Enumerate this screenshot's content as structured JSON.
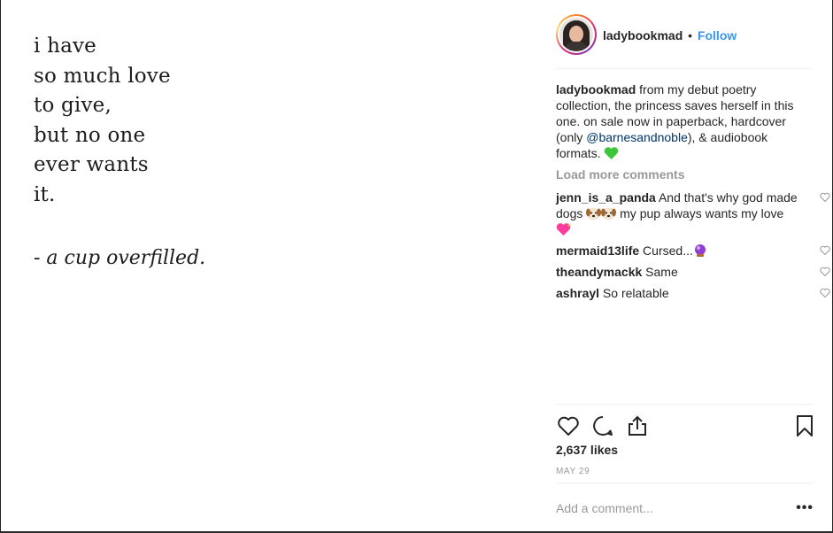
{
  "poem": {
    "lines": [
      "i have",
      "so much love",
      "to give,",
      "but no one",
      "ever wants",
      "it."
    ],
    "signature": "- a cup overfilled."
  },
  "header": {
    "username": "ladybookmad",
    "separator": "•",
    "follow_label": "Follow"
  },
  "caption": {
    "username": "ladybookmad",
    "text_before": " from my debut poetry collection, the princess saves herself in this one. on sale now in paperback, hardcover (only ",
    "mention": "@barnesandnoble",
    "text_after": "), & audiobook formats. ",
    "emoji": "green-heart"
  },
  "load_more_label": "Load more comments",
  "comments": [
    {
      "username": "jenn_is_a_panda",
      "text": " And that's why god made dogs ",
      "emoji_mid": [
        "dog-face",
        "dog-face"
      ],
      "text2": " my pup always wants my love ",
      "emoji_end": "sparkling-heart"
    },
    {
      "username": "mermaid13life",
      "text": " Cursed...",
      "emoji_end": "crystal-ball"
    },
    {
      "username": "theandymackk",
      "text": " Same"
    },
    {
      "username": "ashrayl",
      "text": " So relatable"
    }
  ],
  "likes_label": "2,637 likes",
  "date_label": "MAY 29",
  "add_comment": {
    "placeholder": "Add a comment..."
  },
  "more_label": "•••",
  "colors": {
    "link": "#3897f0",
    "mention": "#003569",
    "muted": "#999999"
  }
}
